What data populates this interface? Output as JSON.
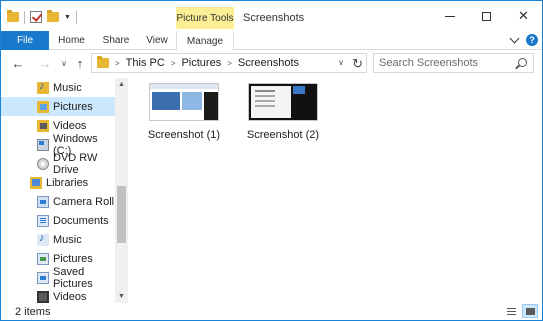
{
  "window": {
    "title": "Screenshots",
    "context_tab": "Picture Tools",
    "caption": {
      "minimize": "—",
      "maximize": "☐",
      "close": "✕"
    }
  },
  "ribbon": {
    "tabs": [
      "File",
      "Home",
      "Share",
      "View",
      "Manage"
    ]
  },
  "nav": {
    "back": "←",
    "forward": "→",
    "recent": "∨",
    "up": "↑",
    "breadcrumb": [
      "This PC",
      "Pictures",
      "Screenshots"
    ],
    "refresh": "↻"
  },
  "search": {
    "placeholder": "Search Screenshots"
  },
  "navpane": {
    "items": [
      {
        "label": "Music",
        "icon": "music-folder-icon"
      },
      {
        "label": "Pictures",
        "icon": "pictures-folder-icon",
        "selected": true
      },
      {
        "label": "Videos",
        "icon": "videos-folder-icon"
      },
      {
        "label": "Windows (C:)",
        "icon": "drive-icon"
      },
      {
        "label": "DVD RW Drive",
        "icon": "dvd-drive-icon"
      },
      {
        "label": "Libraries",
        "icon": "libraries-icon"
      },
      {
        "label": "Camera Roll",
        "icon": "camera-roll-icon"
      },
      {
        "label": "Documents",
        "icon": "documents-icon"
      },
      {
        "label": "Music",
        "icon": "music-library-icon"
      },
      {
        "label": "Pictures",
        "icon": "pictures-library-icon"
      },
      {
        "label": "Saved Pictures",
        "icon": "saved-pictures-icon"
      },
      {
        "label": "Videos",
        "icon": "videos-library-icon"
      }
    ],
    "scroll_up": "▲",
    "scroll_down": "▼"
  },
  "files": [
    {
      "name": "Screenshot (1)"
    },
    {
      "name": "Screenshot (2)"
    }
  ],
  "status": {
    "item_count": "2 items"
  },
  "colors": {
    "accent": "#1979ca",
    "selection": "#cce8ff",
    "context_tab": "#fbee95",
    "border": "#1883d7"
  }
}
